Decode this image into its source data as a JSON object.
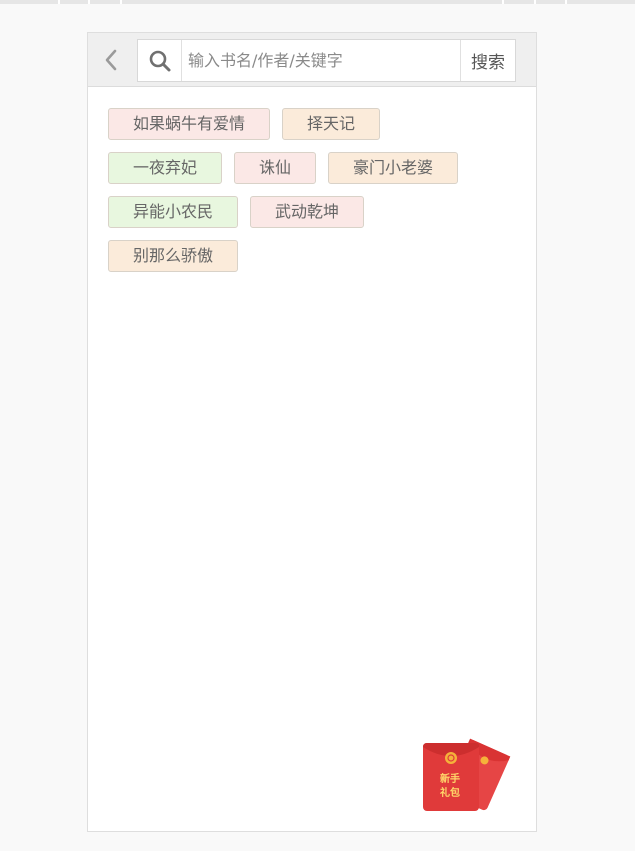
{
  "search": {
    "placeholder": "输入书名/作者/关键字",
    "value": "",
    "button_label": "搜索"
  },
  "header": {
    "back_icon": "chevron-left-icon",
    "search_icon": "search-icon"
  },
  "tags": [
    [
      {
        "label": "如果蜗牛有爱情",
        "color": "pink"
      },
      {
        "label": "择天记",
        "color": "peach"
      }
    ],
    [
      {
        "label": "一夜弃妃",
        "color": "green"
      },
      {
        "label": "诛仙",
        "color": "pink"
      },
      {
        "label": "豪门小老婆",
        "color": "peach"
      }
    ],
    [
      {
        "label": "异能小农民",
        "color": "green"
      },
      {
        "label": "武动乾坤",
        "color": "pink"
      }
    ],
    [
      {
        "label": "别那么骄傲",
        "color": "peach"
      }
    ]
  ],
  "gift": {
    "line1": "新手",
    "line2": "礼包",
    "icon": "red-envelope-icon"
  },
  "colors": {
    "tag_pink": "#fbe8e6",
    "tag_peach": "#fbebda",
    "tag_green": "#e8f7df",
    "envelope_red": "#e03a3a",
    "envelope_gold": "#f5b23a"
  }
}
